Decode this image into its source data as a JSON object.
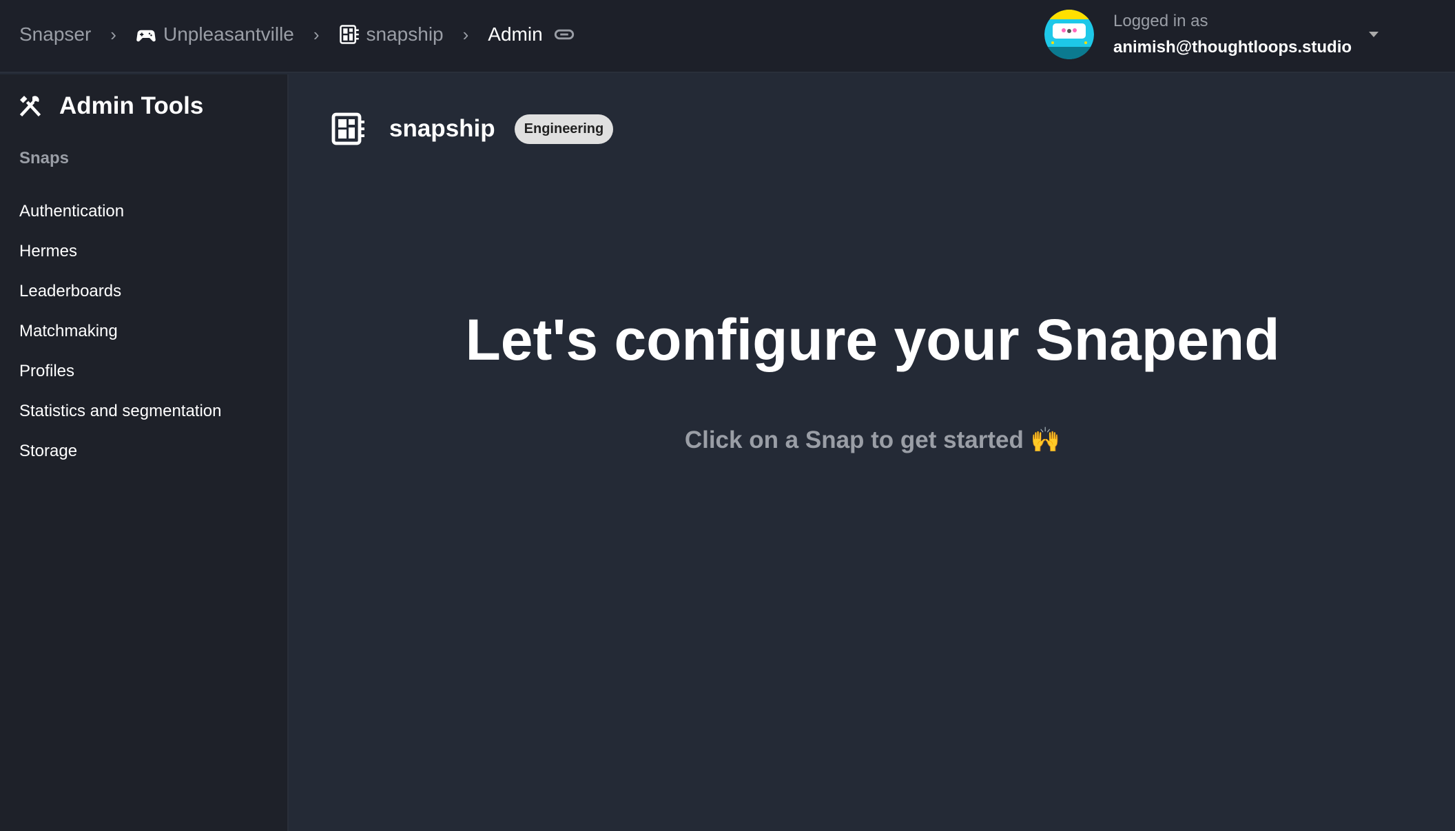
{
  "breadcrumb": [
    {
      "label": "Snapser"
    },
    {
      "label": "Unpleasantville",
      "icon": "gamepad-icon"
    },
    {
      "label": "snapship",
      "icon": "snap-grid-icon"
    },
    {
      "label": "Admin",
      "icon": "link-icon"
    }
  ],
  "user": {
    "logged_in_label": "Logged in as",
    "email": "animish@thoughtloops.studio"
  },
  "sidebar": {
    "title": "Admin Tools",
    "section": "Snaps",
    "items": [
      "Authentication",
      "Hermes",
      "Leaderboards",
      "Matchmaking",
      "Profiles",
      "Statistics and segmentation",
      "Storage"
    ]
  },
  "project": {
    "name": "snapship",
    "badge": "Engineering"
  },
  "main": {
    "heading": "Let's configure your Snapend",
    "subtitle": "Click on a Snap to get started",
    "subtitle_emoji": "🙌"
  },
  "colors": {
    "topbar": "#1d2029",
    "sidebar": "#1e2129",
    "main": "#242a36",
    "badge": "#e0e0e0"
  }
}
